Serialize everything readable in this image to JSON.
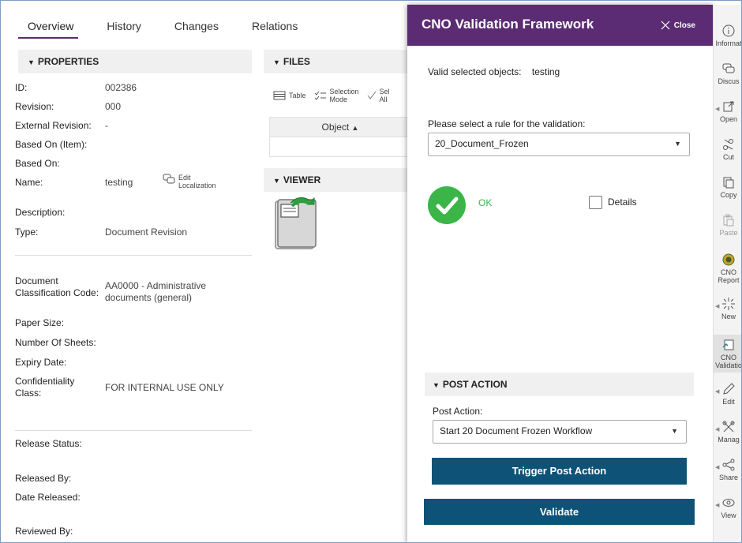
{
  "tabs": [
    "Overview",
    "History",
    "Changes",
    "Relations"
  ],
  "properties": {
    "header": "PROPERTIES",
    "rows": [
      {
        "label": "ID:",
        "value": "002386"
      },
      {
        "label": "Revision:",
        "value": "000"
      },
      {
        "label": "External Revision:",
        "value": "-"
      },
      {
        "label": "Based On (Item):",
        "value": ""
      },
      {
        "label": "Based On:",
        "value": ""
      },
      {
        "label": "Name:",
        "value": "testing"
      },
      {
        "label": "Description:",
        "value": ""
      },
      {
        "label": "Type:",
        "value": "Document Revision"
      },
      {
        "label": "Document Classification Code:",
        "value": "AA0000 - Administrative documents (general)"
      },
      {
        "label": "Paper Size:",
        "value": ""
      },
      {
        "label": "Number Of Sheets:",
        "value": ""
      },
      {
        "label": "Expiry Date:",
        "value": ""
      },
      {
        "label": "Confidentiality Class:",
        "value": "FOR INTERNAL USE ONLY"
      },
      {
        "label": "Release Status:",
        "value": ""
      },
      {
        "label": "Released By:",
        "value": ""
      },
      {
        "label": "Date Released:",
        "value": ""
      },
      {
        "label": "Reviewed By:",
        "value": ""
      }
    ],
    "edit_localization": [
      "Edit",
      "Localization"
    ]
  },
  "files": {
    "header": "FILES",
    "toolbar": {
      "table": "Table",
      "selection_mode": [
        "Selection",
        "Mode"
      ],
      "select_all": [
        "Sel",
        "All"
      ]
    },
    "column": "Object"
  },
  "viewer": {
    "header": "VIEWER"
  },
  "dialog": {
    "title": "CNO Validation Framework",
    "close": "Close",
    "valid_objects_label": "Valid selected objects:",
    "valid_objects_value": "testing",
    "rule_prompt": "Please select a rule for the validation:",
    "rule_selected": "20_Document_Frozen",
    "status": "OK",
    "details_label": "Details",
    "post_action_header": "POST ACTION",
    "post_action_label": "Post Action:",
    "post_action_selected": "Start 20 Document Frozen Workflow",
    "trigger_button": "Trigger Post Action",
    "validate_button": "Validate",
    "colors": {
      "title_bar": "#5b2c73",
      "button": "#0f5277",
      "ok": "#3bb548"
    }
  },
  "rail": [
    {
      "label": "Informat",
      "icon": "info-icon"
    },
    {
      "label": "Discus",
      "icon": "discuss-icon"
    },
    {
      "label": "Open",
      "icon": "open-icon"
    },
    {
      "label": "Cut",
      "icon": "scissors-icon"
    },
    {
      "label": "Copy",
      "icon": "copy-icon"
    },
    {
      "label": "Paste",
      "icon": "paste-icon"
    },
    {
      "label": "CNO Report",
      "icon": "report-icon"
    },
    {
      "label": "New",
      "icon": "new-icon"
    },
    {
      "label": "CNO Validatio",
      "icon": "validation-icon"
    },
    {
      "label": "Edit",
      "icon": "edit-icon"
    },
    {
      "label": "Manag",
      "icon": "manage-icon"
    },
    {
      "label": "Share",
      "icon": "share-icon"
    },
    {
      "label": "View",
      "icon": "view-icon"
    }
  ]
}
